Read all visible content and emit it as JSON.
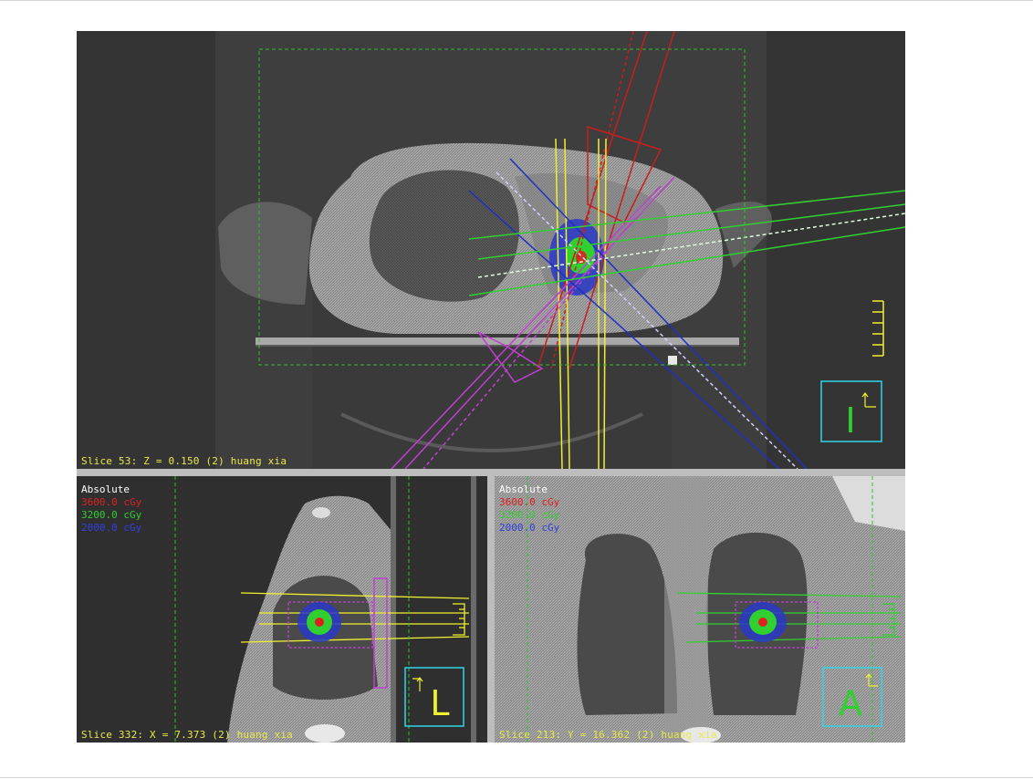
{
  "axial_view": {
    "slice_label": "Slice 53: Z = 0.150 (2) huang xia",
    "orientation_letter": "I"
  },
  "sagittal_view": {
    "slice_label": "Slice 332: X = 7.373 (2) huang xia",
    "orientation_letter": "L",
    "legend": {
      "title": "Absolute",
      "items": [
        {
          "label": "3600.0 cGy",
          "color": "#e02020"
        },
        {
          "label": "3200.0 cGy",
          "color": "#30d030"
        },
        {
          "label": "2000.0 cGy",
          "color": "#3040e0"
        }
      ]
    }
  },
  "coronal_view": {
    "slice_label": "Slice 213: Y = 16.362 (2) huang xia",
    "orientation_letter": "A",
    "legend": {
      "title": "Absolute",
      "items": [
        {
          "label": "3600.0 cGy",
          "color": "#e02020"
        },
        {
          "label": "3200.0 cGy",
          "color": "#30d030"
        },
        {
          "label": "2000.0 cGy",
          "color": "#3040e0"
        }
      ]
    }
  },
  "colors": {
    "isodose_3600": "#e02020",
    "isodose_3200": "#30d030",
    "isodose_2000": "#3040e0",
    "beam_yellow": "#f0f030",
    "beam_magenta": "#c040d0",
    "orientation_box": "#2fd5e6",
    "dashed_guides": "#30c030"
  }
}
